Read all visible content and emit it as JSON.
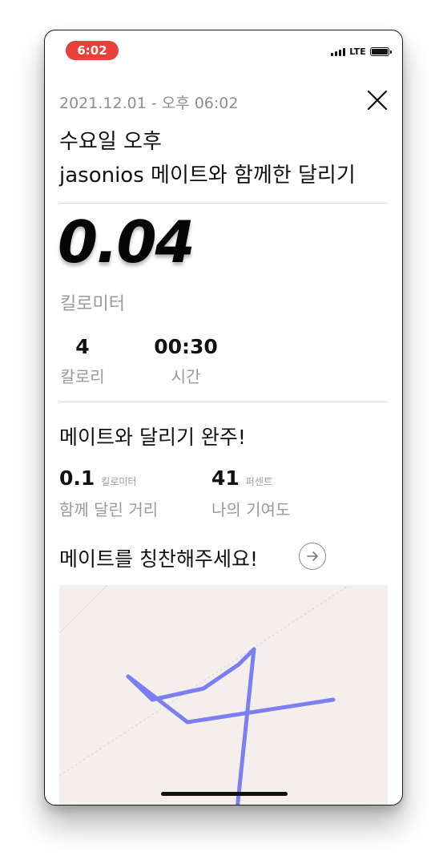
{
  "colors": {
    "status_pill": "#e8403a",
    "route": "#7b7ff2",
    "map_bg": "#f4efec"
  },
  "status_bar": {
    "time": "6:02",
    "network": "LTE"
  },
  "header": {
    "date": "2021.12.01 - 오후 06:02",
    "title_line1": "수요일 오후",
    "title_line2": "jasonios 메이트와 함께한 달리기"
  },
  "summary": {
    "distance": "0.04",
    "distance_unit": "킬로미터",
    "calories_value": "4",
    "calories_label": "칼로리",
    "time_value": "00:30",
    "time_label": "시간"
  },
  "mate": {
    "heading": "메이트와 달리기 완주!",
    "together_value": "0.1",
    "together_unit": "킬로미터",
    "together_label": "함께 달린 거리",
    "contribution_value": "41",
    "contribution_unit": "퍼센트",
    "contribution_label": "나의 기여도"
  },
  "praise": {
    "heading": "메이트를 칭찬해주세요!",
    "arrow_icon": "arrow-right-circle-icon"
  },
  "icons": {
    "close": "close-icon",
    "signal": "signal-icon",
    "battery": "battery-icon"
  }
}
